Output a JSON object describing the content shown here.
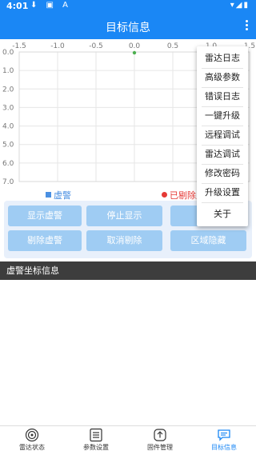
{
  "status": {
    "time": "4:01",
    "left_icons": "⬇ ▣ A",
    "right_icons": "▾◢▮"
  },
  "app": {
    "title": "目标信息",
    "more_icon": "more-vertical-icon"
  },
  "chart_data": {
    "type": "scatter",
    "x_ticks": [
      "-1.5",
      "-1.0",
      "-0.5",
      "0.0",
      "0.5",
      "1.0",
      "1.5"
    ],
    "y_ticks": [
      "0.0",
      "1.0",
      "2.0",
      "3.0",
      "4.0",
      "5.0",
      "6.0",
      "7.0"
    ],
    "xlim": [
      -1.5,
      1.5
    ],
    "ylim": [
      0,
      7
    ],
    "grid": true,
    "series": [
      {
        "name": "虚警",
        "color": "#4a90e2",
        "points": []
      },
      {
        "name": "已剔除",
        "color": "#e53935",
        "points": []
      },
      {
        "points": [
          {
            "x": 0.0,
            "y": 0.0
          }
        ],
        "color": "#4caf50"
      }
    ]
  },
  "legend": {
    "item1": "虚警",
    "item2": "已剔除虚警"
  },
  "buttons": {
    "show_false": "显示虚警",
    "stop_show": "停止显示",
    "delete_false": "剔除虚警",
    "cancel_delete": "取消剔除",
    "area_hide": "区域隐藏"
  },
  "section": {
    "title": "虚警坐标信息"
  },
  "menu": {
    "items": [
      "雷达日志",
      "高级参数",
      "错误日志",
      "一键升级",
      "远程调试",
      "雷达调试",
      "修改密码",
      "升级设置",
      "关于"
    ]
  },
  "nav": {
    "items": [
      {
        "label": "雷达状态",
        "icon": "radar-icon"
      },
      {
        "label": "参数设置",
        "icon": "settings-list-icon"
      },
      {
        "label": "固件管理",
        "icon": "firmware-upload-icon"
      },
      {
        "label": "目标信息",
        "icon": "message-icon"
      }
    ],
    "active_color": "#1a87f5"
  }
}
